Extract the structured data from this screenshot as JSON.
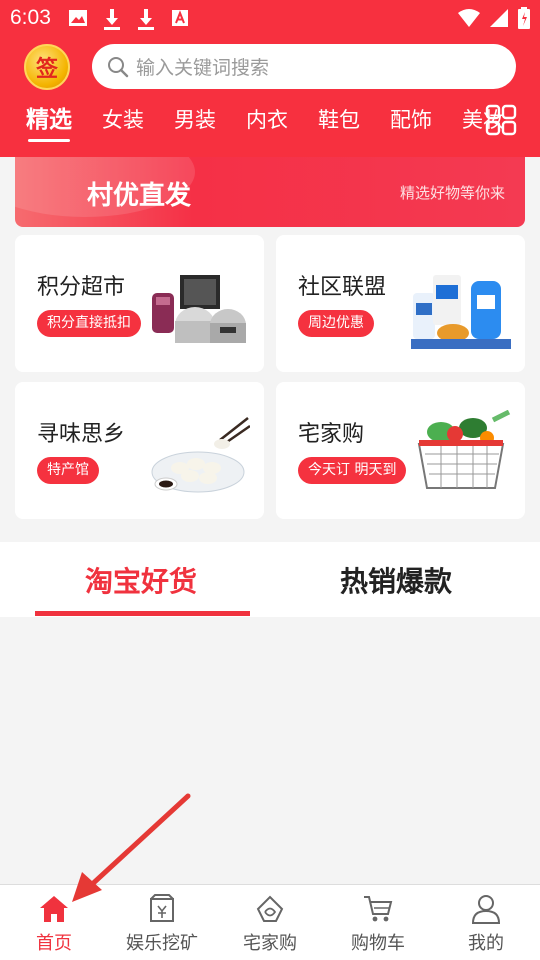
{
  "status": {
    "time": "6:03"
  },
  "header": {
    "sign_label": "签",
    "search_placeholder": "输入关键词搜索",
    "categories": [
      "精选",
      "女装",
      "男装",
      "内衣",
      "鞋包",
      "配饰",
      "美妆"
    ]
  },
  "banner": {
    "title": "村优直发",
    "subtitle": "精选好物等你来"
  },
  "cards": [
    {
      "title": "积分超市",
      "tag": "积分直接抵扣"
    },
    {
      "title": "社区联盟",
      "tag": "周边优惠"
    },
    {
      "title": "寻味思乡",
      "tag": "特产馆"
    },
    {
      "title": "宅家购",
      "tag": "今天订 明天到"
    }
  ],
  "tabs": [
    "淘宝好货",
    "热销爆款"
  ],
  "bottom_nav": [
    {
      "label": "首页",
      "icon": "home-icon",
      "active": true
    },
    {
      "label": "娱乐挖矿",
      "icon": "mining-bag-icon",
      "active": false
    },
    {
      "label": "宅家购",
      "icon": "home-shop-icon",
      "active": false
    },
    {
      "label": "购物车",
      "icon": "cart-icon",
      "active": false
    },
    {
      "label": "我的",
      "icon": "user-icon",
      "active": false
    }
  ],
  "colors": {
    "primary": "#f7303f",
    "accent_tab": "#f0323e",
    "badge_gold": "#f4b400"
  }
}
